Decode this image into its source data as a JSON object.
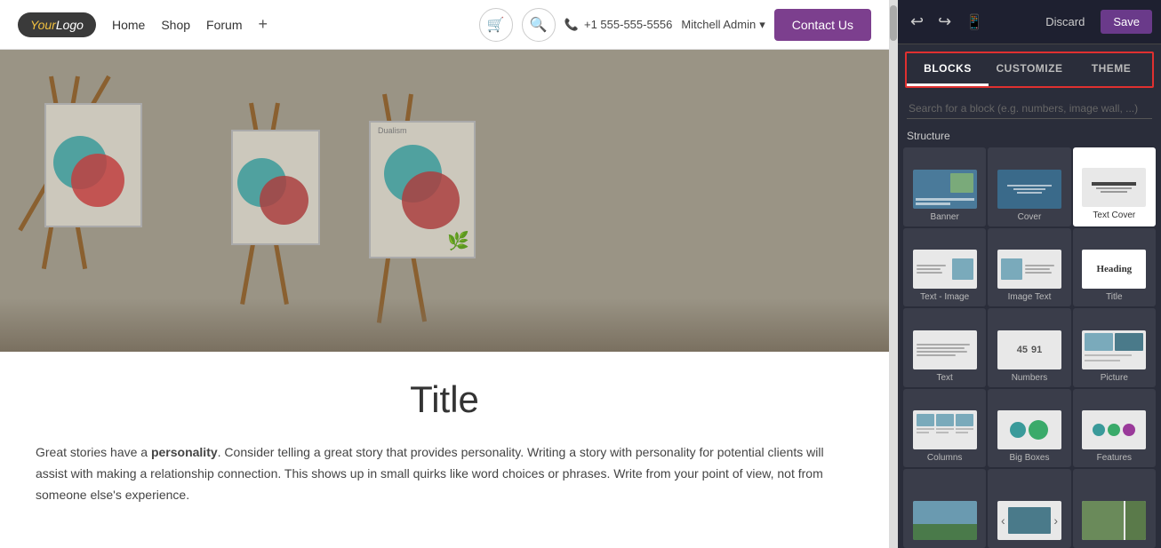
{
  "navbar": {
    "logo_text": "YourLogo",
    "nav_items": [
      {
        "label": "Home"
      },
      {
        "label": "Shop"
      },
      {
        "label": "Forum"
      },
      {
        "label": "+"
      }
    ],
    "phone": "+1 555-555-5556",
    "admin": "Mitchell Admin",
    "contact_btn": "Contact Us"
  },
  "hero": {
    "alt": "Bedroom with paintings on easels"
  },
  "content": {
    "title": "Title",
    "body": "Great stories have a personality. Consider telling a great story that provides personality. Writing a story with personality for potential clients will assist with making a relationship connection. This shows up in small quirks like word choices or phrases. Write from your point of view, not from someone else's experience."
  },
  "panel": {
    "toolbar": {
      "undo_label": "↩",
      "redo_label": "↪",
      "device_icon": "📱",
      "discard_label": "Discard",
      "save_label": "Save"
    },
    "tabs": [
      {
        "label": "BLOCKS",
        "active": true
      },
      {
        "label": "CUSTOMIZE",
        "active": false
      },
      {
        "label": "THEME",
        "active": false
      }
    ],
    "search_placeholder": "Search for a block (e.g. numbers, image wall, ...)",
    "structure_label": "Structure",
    "blocks": [
      {
        "id": "banner",
        "label": "Banner",
        "thumb": "banner"
      },
      {
        "id": "cover",
        "label": "Cover",
        "thumb": "cover"
      },
      {
        "id": "text-cover",
        "label": "Text Cover",
        "thumb": "textcover"
      },
      {
        "id": "text-image",
        "label": "Text - Image",
        "thumb": "textimage"
      },
      {
        "id": "image-text",
        "label": "Image Text",
        "thumb": "imagetext"
      },
      {
        "id": "title",
        "label": "Title",
        "thumb": "title",
        "active": true
      },
      {
        "id": "text",
        "label": "Text",
        "thumb": "text"
      },
      {
        "id": "numbers",
        "label": "Numbers",
        "thumb": "numbers"
      },
      {
        "id": "picture",
        "label": "Picture",
        "thumb": "picture"
      },
      {
        "id": "columns",
        "label": "Columns",
        "thumb": "columns"
      },
      {
        "id": "big-boxes",
        "label": "Big Boxes",
        "thumb": "bigboxes"
      },
      {
        "id": "features",
        "label": "Features",
        "thumb": "features"
      },
      {
        "id": "landscape",
        "label": "",
        "thumb": "landscape"
      },
      {
        "id": "slider",
        "label": "",
        "thumb": "slider"
      },
      {
        "id": "landscape2",
        "label": "",
        "thumb": "landscape2"
      }
    ]
  }
}
